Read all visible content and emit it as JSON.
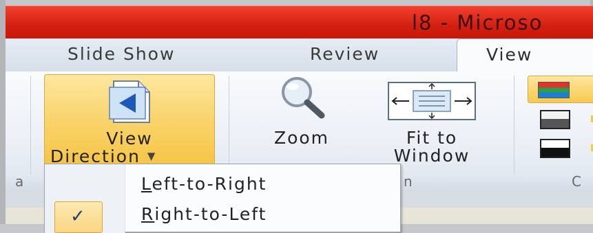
{
  "window": {
    "title": "l8  -  Microso"
  },
  "tabs": [
    {
      "label": "Slide Show",
      "active": false
    },
    {
      "label": "Review",
      "active": false
    },
    {
      "label": "View",
      "active": true
    }
  ],
  "ribbon": {
    "view_direction": {
      "line1": "View",
      "line2": "Direction"
    },
    "zoom": {
      "label": "Zoom"
    },
    "fit_to_window": {
      "line1": "Fit to",
      "line2": "Window"
    },
    "group_label_fragment_left": "a",
    "group_label_fragment_mid": "n",
    "group_label_fragment_right": "C",
    "icons": {
      "view_direction": "page-arrow-left-icon",
      "zoom": "magnifier-icon",
      "fit_to_window": "fit-window-icon",
      "color": "color-swatch-icon",
      "grayscale": "grayscale-icon",
      "black_white": "black-white-icon"
    }
  },
  "dropdown": {
    "items": [
      {
        "label": "Left-to-Right",
        "accelerator": "L",
        "rest": "eft-to-Right",
        "checked": false
      },
      {
        "label": "Right-to-Left",
        "accelerator": "R",
        "rest": "ight-to-Left",
        "checked": true
      }
    ]
  },
  "colors": {
    "titlebar": "#d31f0f",
    "highlight": "#f9d36b",
    "check": "#1f3f7a"
  }
}
